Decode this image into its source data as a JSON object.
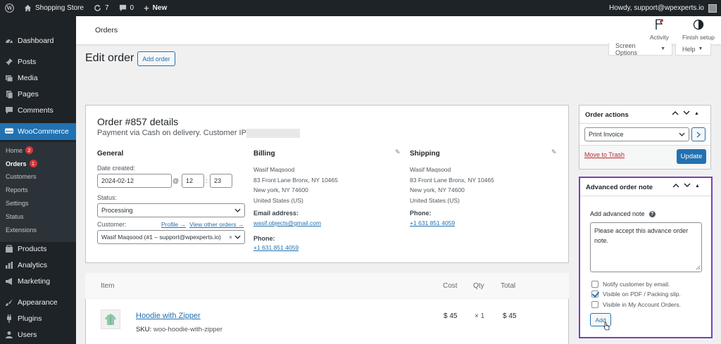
{
  "adminbar": {
    "site_name": "Shopping Store",
    "updates_count": "7",
    "comments_count": "0",
    "new_label": "New",
    "howdy": "Howdy, support@wpexperts.io"
  },
  "sidebar": {
    "dashboard": "Dashboard",
    "posts": "Posts",
    "media": "Media",
    "pages": "Pages",
    "comments": "Comments",
    "woocommerce": "WooCommerce",
    "sub": {
      "home": "Home",
      "home_badge": "2",
      "orders": "Orders",
      "orders_badge": "1",
      "customers": "Customers",
      "reports": "Reports",
      "settings": "Settings",
      "status": "Status",
      "extensions": "Extensions"
    },
    "products": "Products",
    "analytics": "Analytics",
    "marketing": "Marketing",
    "appearance": "Appearance",
    "plugins": "Plugins",
    "users": "Users"
  },
  "header": {
    "title": "Orders",
    "activity": "Activity",
    "finish_setup": "Finish setup",
    "screen_options": "Screen Options",
    "help": "Help"
  },
  "page": {
    "title": "Edit order",
    "add_order": "Add order"
  },
  "order": {
    "title": "Order #857 details",
    "subtitle": "Payment via Cash on delivery. Customer IP:",
    "general": {
      "heading": "General",
      "date_label": "Date created:",
      "date_value": "2024-02-12",
      "at": "@",
      "hour": "12",
      "colon": ":",
      "minute": "23",
      "status_label": "Status:",
      "status_value": "Processing",
      "customer_label": "Customer:",
      "profile_link": "Profile →",
      "other_orders_link": "View other orders →",
      "customer_value": "Wasif Maqsood (#1 – support@wpexperts.io)",
      "clear": "×"
    },
    "billing": {
      "heading": "Billing",
      "name": "Wasif Maqsood",
      "line1": "83 Front Lane Bronx, NY 10465",
      "line2": "New york, NY 74600",
      "country": "United States (US)",
      "email_label": "Email address:",
      "email": "wasif.objects@gmail.com",
      "phone_label": "Phone:",
      "phone": "+1 631 851 4059"
    },
    "shipping": {
      "heading": "Shipping",
      "name": "Wasif Maqsood",
      "line1": "83 Front Lane Bronx, NY 10465",
      "line2": "New york, NY 74600",
      "country": "United States (US)",
      "phone_label": "Phone:",
      "phone": "+1 631 851 4059"
    }
  },
  "items": {
    "headers": {
      "item": "Item",
      "cost": "Cost",
      "qty": "Qty",
      "total": "Total"
    },
    "rows": [
      {
        "name": "Hoodie with Zipper",
        "sku_label": "SKU:",
        "sku": "woo-hoodie-with-zipper",
        "cost": "$ 45",
        "qty": "× 1",
        "total": "$ 45"
      }
    ]
  },
  "order_actions": {
    "title": "Order actions",
    "selected": "Print Invoice",
    "trash": "Move to Trash",
    "update": "Update"
  },
  "advanced_note": {
    "title": "Advanced order note",
    "label": "Add advanced note",
    "text": "Please accept this advance order note.",
    "checkboxes": [
      {
        "label": "Notify customer by email.",
        "checked": false
      },
      {
        "label": "Visible on PDF / Packing slip.",
        "checked": true
      },
      {
        "label": "Visible in My Account Orders.",
        "checked": false
      }
    ],
    "add": "Add"
  },
  "colors": {
    "admin_dark": "#1d2327",
    "accent": "#2271b1",
    "highlight_border": "#7b3fb6",
    "badge": "#d63638",
    "trash": "#b32d2e"
  }
}
